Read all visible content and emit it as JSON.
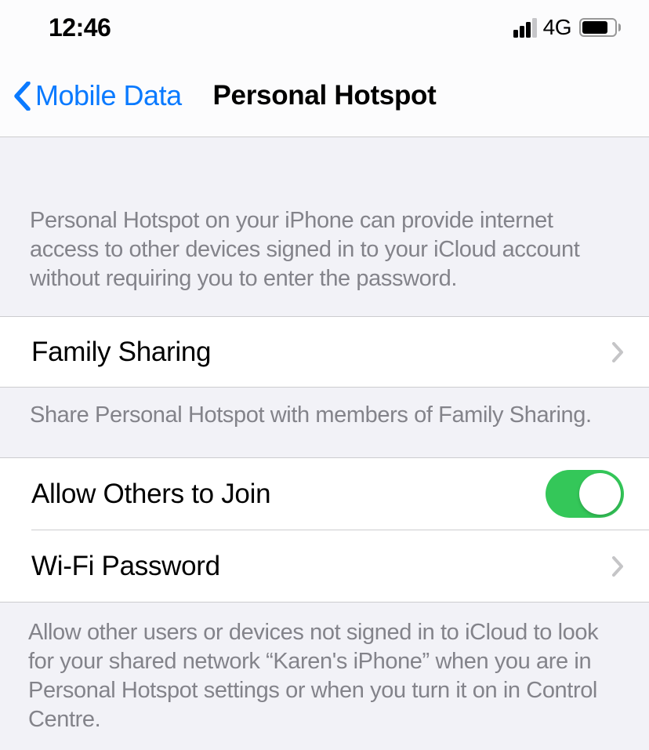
{
  "status_bar": {
    "time": "12:46",
    "network": "4G"
  },
  "nav": {
    "back_label": "Mobile Data",
    "title": "Personal Hotspot"
  },
  "intro_description": "Personal Hotspot on your iPhone can provide internet access to other devices signed in to your iCloud account without requiring you to enter the password.",
  "family_sharing": {
    "label": "Family Sharing",
    "footer": "Share Personal Hotspot with members of Family Sharing."
  },
  "allow_others": {
    "label": "Allow Others to Join",
    "enabled": true
  },
  "wifi_password": {
    "label": "Wi-Fi Password"
  },
  "footer_description": "Allow other users or devices not signed in to iCloud to look for your shared network “Karen's iPhone” when you are in Personal Hotspot settings or when you turn it on in Control Centre.",
  "colors": {
    "accent": "#0a7aff",
    "toggle_on": "#34c759",
    "background": "#f2f2f7",
    "cell": "#ffffff",
    "secondary_text": "#83838a",
    "divider": "#cccccf"
  }
}
